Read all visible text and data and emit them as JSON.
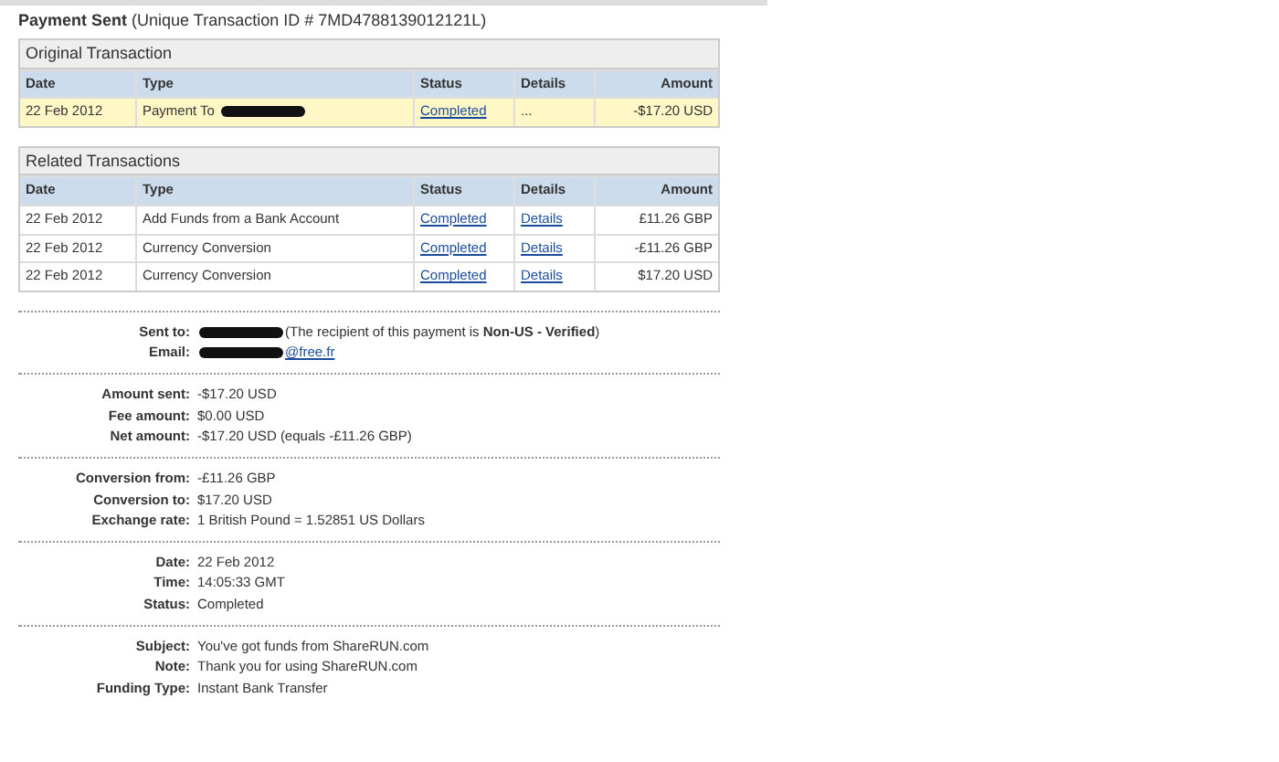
{
  "title": {
    "label": "Payment Sent",
    "detail": "(Unique Transaction ID # 7MD4788139012121L)"
  },
  "tables": [
    {
      "heading": "Original Transaction",
      "highlight": true,
      "columns": [
        "Date",
        "Type",
        "Status",
        "Details",
        "Amount"
      ],
      "rows": [
        {
          "date": "22 Feb 2012",
          "type": "Payment To",
          "redacted": true,
          "status": "Completed",
          "details": "...",
          "details_link": false,
          "amount": "-$17.20 USD"
        }
      ]
    },
    {
      "heading": "Related Transactions",
      "columns": [
        "Date",
        "Type",
        "Status",
        "Details",
        "Amount"
      ],
      "rows": [
        {
          "date": "22 Feb 2012",
          "type": "Add Funds from a Bank Account",
          "status": "Completed",
          "details": "Details",
          "details_link": true,
          "amount": "£11.26 GBP"
        },
        {
          "date": "22 Feb 2012",
          "type": "Currency Conversion",
          "status": "Completed",
          "details": "Details",
          "details_link": true,
          "amount": "-£11.26 GBP"
        },
        {
          "date": "22 Feb 2012",
          "type": "Currency Conversion",
          "status": "Completed",
          "details": "Details",
          "details_link": true,
          "amount": "$17.20 USD"
        }
      ]
    }
  ],
  "sections": [
    [
      {
        "label": "Sent to:",
        "kind": "redacted_text",
        "value": "(The recipient of this payment is **Non-US - Verified**)"
      },
      {
        "label": "Email:",
        "kind": "redacted_link",
        "value": "@free.fr"
      }
    ],
    [
      {
        "label": "Amount sent:",
        "kind": "text",
        "value": "-$17.20 USD"
      },
      {
        "label": "Fee amount:",
        "kind": "text",
        "value": "$0.00 USD"
      },
      {
        "label": "Net amount:",
        "kind": "text",
        "value": "-$17.20 USD (equals -£11.26 GBP)"
      }
    ],
    [
      {
        "label": "Conversion from:",
        "kind": "text",
        "value": "-£11.26 GBP"
      },
      {
        "label": "Conversion to:",
        "kind": "text",
        "value": "$17.20 USD"
      },
      {
        "label": "Exchange rate:",
        "kind": "text",
        "value": "1 British Pound = 1.52851 US Dollars"
      }
    ],
    [
      {
        "label": "Date:",
        "kind": "text",
        "value": "22 Feb 2012"
      },
      {
        "label": "Time:",
        "kind": "text",
        "value": "14:05:33 GMT"
      },
      {
        "label": "Status:",
        "kind": "text",
        "value": "Completed"
      }
    ],
    [
      {
        "label": "Subject:",
        "kind": "text",
        "value": "You've got funds from ShareRUN.com"
      },
      {
        "label": "Note:",
        "kind": "text",
        "value": "Thank you for using ShareRUN.com"
      },
      {
        "label": "Funding Type:",
        "kind": "text",
        "value": "Instant Bank Transfer"
      }
    ]
  ]
}
